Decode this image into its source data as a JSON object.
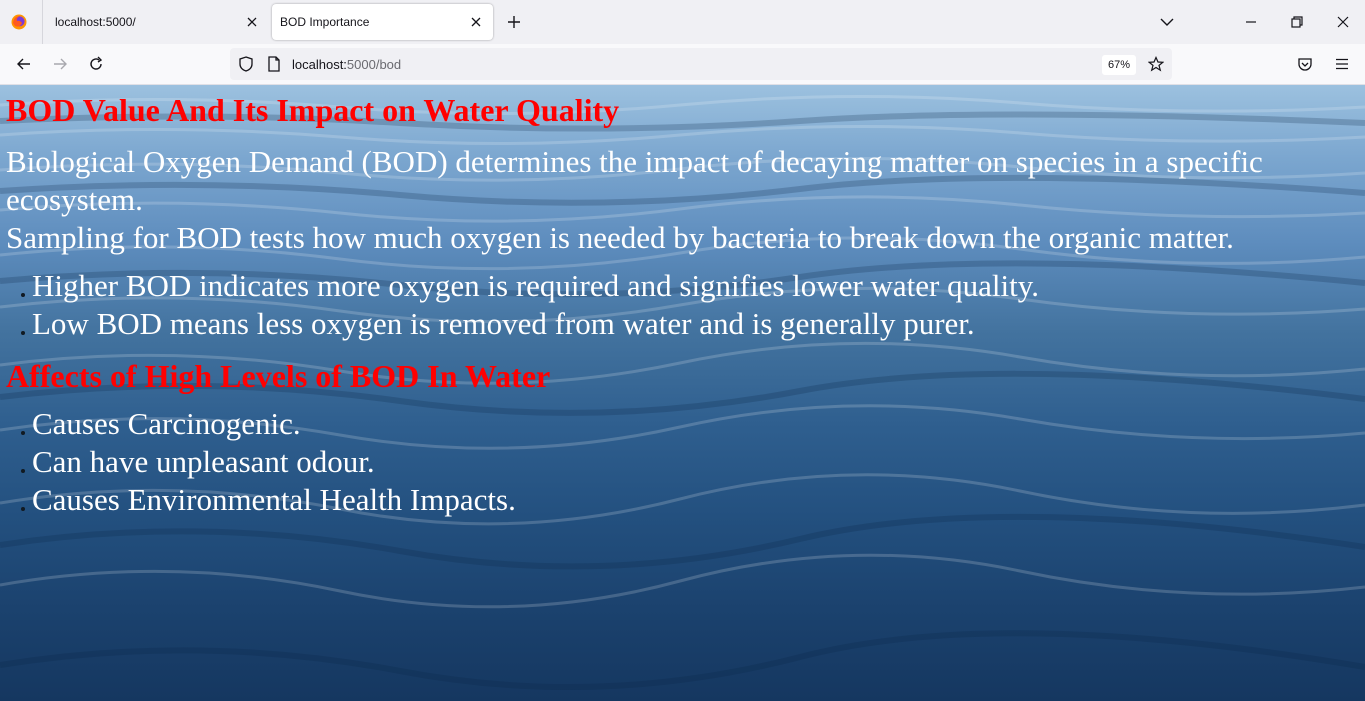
{
  "browser": {
    "tabs": [
      {
        "label": "localhost:5000/",
        "active": false
      },
      {
        "label": "BOD Importance",
        "active": true
      }
    ],
    "url": {
      "host": "localhost:",
      "path": "5000/bod"
    },
    "zoom": "67%",
    "icons": [
      "firefox-logo-icon",
      "close-icon",
      "plus-icon",
      "chevron-down-icon",
      "minimize-icon",
      "restore-icon",
      "window-close-icon",
      "back-arrow-icon",
      "forward-arrow-icon",
      "reload-icon",
      "shield-icon",
      "page-icon",
      "star-icon",
      "pocket-icon",
      "menu-icon"
    ]
  },
  "page": {
    "heading": "BOD Value And Its Impact on Water Quality",
    "paragraph1": "Biological Oxygen Demand (BOD) determines the impact of decaying matter on species in a specific ecosystem.",
    "paragraph2": "Sampling for BOD tests how much oxygen is needed by bacteria to break down the organic matter.",
    "list1": [
      "Higher BOD indicates more oxygen is required and signifies lower water quality.",
      "Low BOD means less oxygen is removed from water and is generally purer."
    ],
    "subheading": "Affects of High Levels of BOD In Water",
    "list2": [
      "Causes Carcinogenic.",
      "Can have unpleasant odour.",
      "Causes Environmental Health Impacts."
    ],
    "colors": {
      "heading": "#ff0000",
      "text": "#ffffff",
      "water_top": "#9cc1df",
      "water_bottom": "#153760"
    }
  }
}
